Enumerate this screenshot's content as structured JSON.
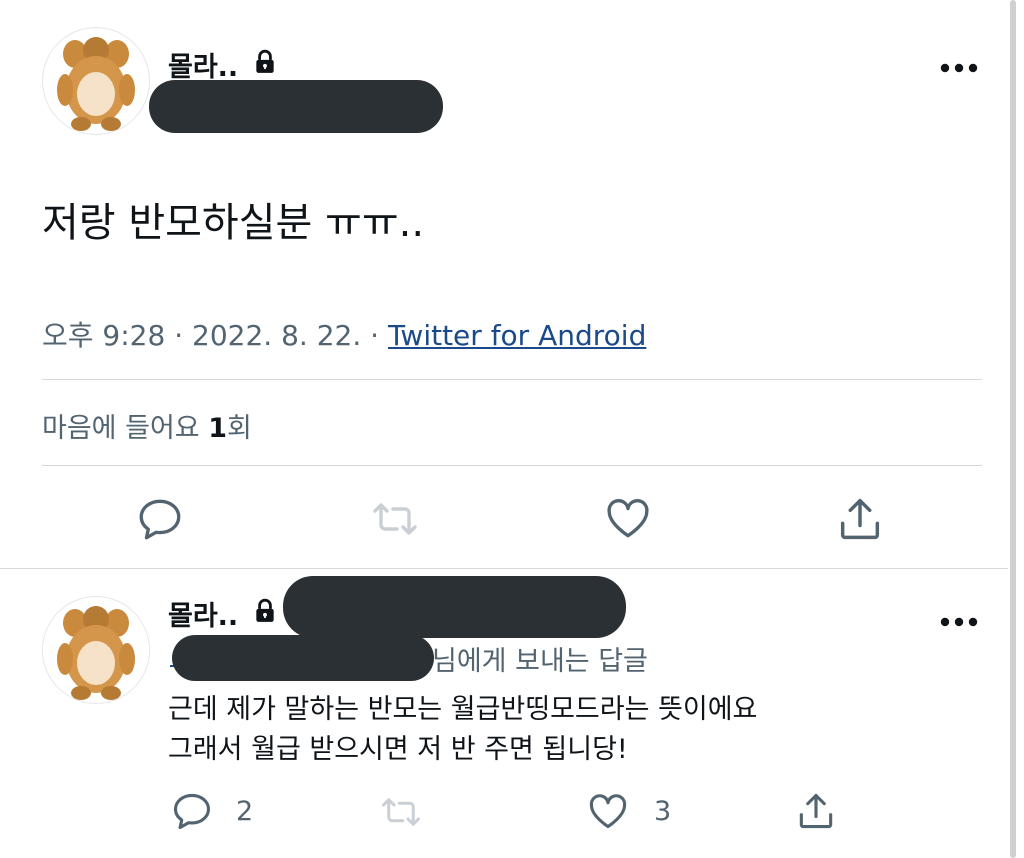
{
  "tweet": {
    "author_name": "몰라..",
    "text": "저랑 반모하실분 ㅠㅠ..",
    "time": "오후 9:28",
    "separator": "·",
    "date": "2022. 8. 22.",
    "source": "Twitter for Android",
    "likes_label": "마음에 들어요",
    "likes_count": "1",
    "likes_suffix": "회"
  },
  "reply": {
    "author_name": "몰라..",
    "reply_to_suffix": "님에게 보내는 답글",
    "line1": "근데 제가 말하는 반모는 월급반띵모드라는 뜻이에요",
    "line2": "그래서 월급 받으시면 저 반 주면 됩니당!",
    "reply_count": "2",
    "like_count": "3"
  },
  "icons": {
    "more": "more-icon",
    "lock": "lock-icon",
    "reply": "reply-icon",
    "retweet": "retweet-icon",
    "like": "heart-icon",
    "share": "share-icon"
  }
}
